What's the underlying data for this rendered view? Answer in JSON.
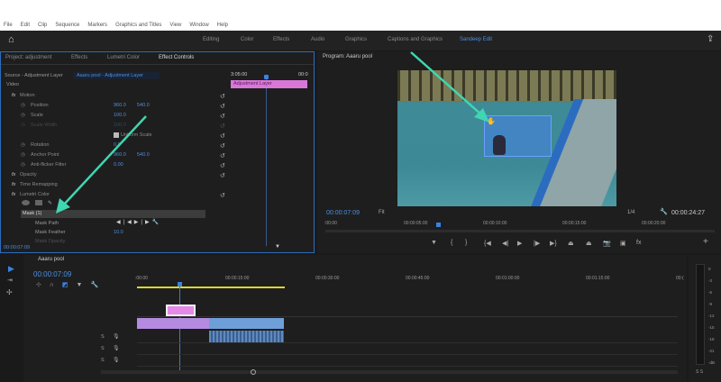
{
  "menu": [
    "File",
    "Edit",
    "Clip",
    "Sequence",
    "Markers",
    "Graphics and Titles",
    "View",
    "Window",
    "Help"
  ],
  "workspaces": [
    {
      "label": "Editing"
    },
    {
      "label": "Color"
    },
    {
      "label": "Effects"
    },
    {
      "label": "Audio"
    },
    {
      "label": "Graphics"
    },
    {
      "label": "Captions and Graphics"
    },
    {
      "label": "Sandeep Edit",
      "active": true
    }
  ],
  "left_tabs": [
    "Project: adjustment",
    "Effects",
    "Lumetri Color",
    "Effect Controls"
  ],
  "source_label": "Source - Adjustment Layer",
  "clip_label": "Aaaru pool - Adjustment Layer",
  "ec_time_start": "3:05:00",
  "ec_time_end": "00:0",
  "ec_clip": "Adjustment Layer",
  "video_label": "Video",
  "props": [
    {
      "name": "Motion",
      "fx": true,
      "v1": "",
      "v2": ""
    },
    {
      "name": "Position",
      "v1": "960.0",
      "v2": "540.0"
    },
    {
      "name": "Scale",
      "v1": "100.0",
      "v2": ""
    },
    {
      "name": "Scale Width",
      "v1": "100.0",
      "v2": "",
      "dim": true
    },
    {
      "name": "",
      "v1": "Uniform Scale",
      "v2": ""
    },
    {
      "name": "Rotation",
      "v1": "0.0",
      "v2": ""
    },
    {
      "name": "Anchor Point",
      "v1": "960.0",
      "v2": "540.0"
    },
    {
      "name": "Anti-flicker Filter",
      "v1": "0.00",
      "v2": ""
    },
    {
      "name": "Opacity",
      "fx": true,
      "v1": "",
      "v2": ""
    },
    {
      "name": "Time Remapping",
      "fx": true,
      "v1": "",
      "v2": ""
    },
    {
      "name": "Lumetri Color",
      "fx": true,
      "v1": "",
      "v2": ""
    }
  ],
  "mask": {
    "label": "Mask (1)",
    "path": "Mask Path",
    "feather": "Mask Feather",
    "feather_val": "10.0",
    "expansion": "Mask Opacity"
  },
  "ec_timecode": "00:00:07:09",
  "program": {
    "title": "Program: Aaaru pool",
    "timecode": "00:00:07:09",
    "fit": "Fit",
    "res": "1/4",
    "duration": "00:00:24:27",
    "ruler": [
      ":00:00",
      "00:00:05:00",
      "00:00:10:00",
      "00:00:15:00",
      "00:00:20:00",
      "00:"
    ]
  },
  "timeline": {
    "title": "Aaaru pool",
    "timecode": "00:00:07:09",
    "ruler": [
      ":00:00",
      "00:00:15:00",
      "00:00:30:00",
      "00:00:45:00",
      "00:01:00:00",
      "00:01:15:00",
      "00:("
    ],
    "tracks": [
      "S",
      "S",
      "S"
    ]
  },
  "meter": {
    "scale": [
      "0",
      "-3",
      "-6",
      "-9",
      "-12",
      "-15",
      "-18",
      "-21",
      "-dB"
    ],
    "labels": "S S"
  }
}
